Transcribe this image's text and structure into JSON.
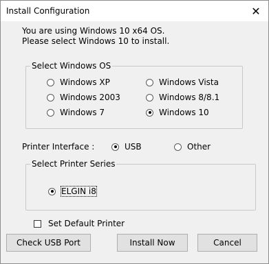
{
  "window": {
    "title": "Install Configuration",
    "close_glyph": "✕"
  },
  "info": {
    "line1": "You are using Windows 10 x64 OS.",
    "line2": "Please select Windows 10 to install."
  },
  "os_group": {
    "legend": "Select Windows OS",
    "options": [
      {
        "label": "Windows XP",
        "checked": false
      },
      {
        "label": "Windows Vista",
        "checked": false
      },
      {
        "label": "Windows 2003",
        "checked": false
      },
      {
        "label": "Windows 8/8.1",
        "checked": false
      },
      {
        "label": "Windows 7",
        "checked": false
      },
      {
        "label": "Windows 10",
        "checked": true
      }
    ]
  },
  "printer_interface": {
    "label": "Printer Interface :",
    "options": [
      {
        "label": "USB",
        "checked": true
      },
      {
        "label": "Other",
        "checked": false
      }
    ]
  },
  "printer_series": {
    "legend": "Select Printer Series",
    "option": {
      "label": "ELGIN i8",
      "checked": true
    }
  },
  "set_default": {
    "label": "Set Default Printer",
    "checked": false
  },
  "buttons": {
    "check_usb": "Check USB Port",
    "install": "Install Now",
    "cancel": "Cancel"
  }
}
